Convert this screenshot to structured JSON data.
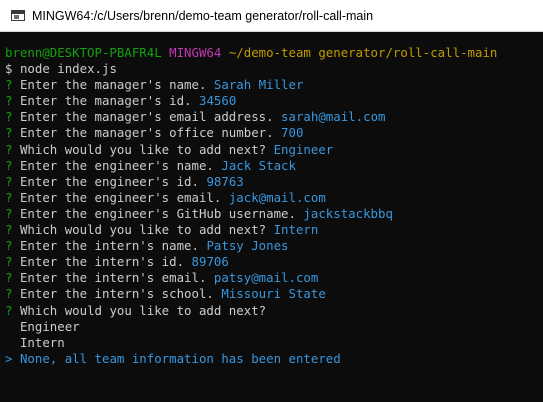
{
  "window": {
    "title": "MINGW64:/c/Users/brenn/demo-team generator/roll-call-main"
  },
  "prompt": {
    "user_host": "brenn@DESKTOP-PBAFR4L",
    "env": "MINGW64",
    "path": "~/demo-team generator/roll-call-main",
    "symbol": "$",
    "command": "node index.js"
  },
  "qa": [
    {
      "mark": "?",
      "q": "Enter the manager's name.",
      "a": "Sarah Miller"
    },
    {
      "mark": "?",
      "q": "Enter the manager's id.",
      "a": "34560"
    },
    {
      "mark": "?",
      "q": "Enter the manager's email address.",
      "a": "sarah@mail.com"
    },
    {
      "mark": "?",
      "q": "Enter the manager's office number.",
      "a": "700"
    },
    {
      "mark": "?",
      "q": "Which would you like to add next?",
      "a": "Engineer"
    },
    {
      "mark": "?",
      "q": "Enter the engineer's name.",
      "a": "Jack Stack"
    },
    {
      "mark": "?",
      "q": "Enter the engineer's id.",
      "a": "98763"
    },
    {
      "mark": "?",
      "q": "Enter the engineer's email.",
      "a": "jack@mail.com"
    },
    {
      "mark": "?",
      "q": "Enter the engineer's GitHub username.",
      "a": "jackstackbbq"
    },
    {
      "mark": "?",
      "q": "Which would you like to add next?",
      "a": "Intern"
    },
    {
      "mark": "?",
      "q": "Enter the intern's name.",
      "a": "Patsy Jones"
    },
    {
      "mark": "?",
      "q": "Enter the intern's id.",
      "a": "89706"
    },
    {
      "mark": "?",
      "q": "Enter the intern's email.",
      "a": "patsy@mail.com"
    },
    {
      "mark": "?",
      "q": "Enter the intern's school.",
      "a": "Missouri State"
    }
  ],
  "final_question": {
    "mark": "?",
    "q": "Which would you like to add next?"
  },
  "choices": [
    {
      "pointer": " ",
      "label": "Engineer",
      "selected": false
    },
    {
      "pointer": " ",
      "label": "Intern",
      "selected": false
    },
    {
      "pointer": ">",
      "label": "None, all team information has been entered",
      "selected": true
    }
  ],
  "colors": {
    "background": "#0c0c0c",
    "text": "#cccccc",
    "green": "#13a10e",
    "purple": "#c239b3",
    "yellow": "#c19c00",
    "blue": "#3a96dd"
  },
  "icons": {
    "title_icon": "terminal-window-icon"
  }
}
